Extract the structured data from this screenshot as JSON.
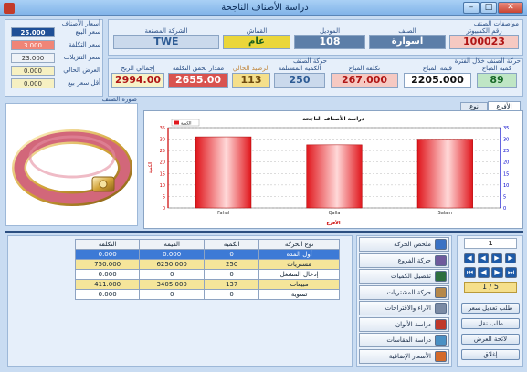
{
  "window": {
    "title": "دراسة الأصناف الناجحة",
    "min": "–",
    "max": "□",
    "close": "✕"
  },
  "spec": {
    "header": "مواصفات الصنف",
    "computer_no_label": "رقم الكمبيوتر",
    "computer_no": "100023",
    "category_label": "الصنف",
    "category": "اسوارة",
    "model_label": "الموديل",
    "model": "108",
    "material_label": "القماش",
    "material": "عام",
    "manufacturer_label": "الشركة المصنعة",
    "manufacturer": "TWE"
  },
  "prices": {
    "header": "أسعار الأصناف",
    "sale_label": "سعر البيع",
    "sale": "25.000",
    "cost_label": "سعر التكلفة",
    "cost": "3.000",
    "discount_label": "سعر التنزيلات",
    "discount": "23.000",
    "offer_label": "العرض الحالي",
    "offer": "0.000",
    "min_label": "أقل سعر بيع",
    "min": "0.000"
  },
  "movement_period": {
    "header": "حركة الصنف خلال الفترة",
    "qty_sold_label": "كمية المباع",
    "qty_sold": "89",
    "value_sold_label": "قيمة المباع",
    "value_sold": "2205.000",
    "cost_sold_label": "تكلفة المباع",
    "cost_sold": "267.000"
  },
  "movement": {
    "header": "حركة الصنف",
    "qty_received_label": "الكمية المستلمة",
    "qty_received": "250",
    "current_balance_label": "الرصيد الحالي",
    "current_balance": "113",
    "cost_realized_label": "مقدار تحقق التكلفة",
    "cost_realized": "2655.00",
    "total_profit_label": "إجمالي الربح",
    "total_profit": "2994.00"
  },
  "image_label": "صورة الصنف",
  "tabs": [
    "الأفرع",
    "نوع السعر"
  ],
  "chart_data": {
    "type": "bar",
    "title": "دراسة الأصناف الناجحة",
    "categories": [
      "Fahal",
      "Qalla",
      "Salam"
    ],
    "values": [
      31,
      27.5,
      30
    ],
    "ylim": [
      0,
      35
    ],
    "yticks": [
      0,
      5,
      10,
      15,
      20,
      25,
      30,
      35
    ],
    "xlabel": "الأفرع",
    "ylabel": "الكمية",
    "legend": [
      "الكمية"
    ],
    "legend_position": "top-left",
    "grid": true,
    "bar_color": "#e0161c"
  },
  "table": {
    "headers": [
      "نوع الحركة",
      "الكمية",
      "القيمة",
      "التكلفة"
    ],
    "rows": [
      {
        "type": "أول المدة",
        "qty": "0",
        "value": "0.000",
        "cost": "0.000",
        "style": "selected"
      },
      {
        "type": "مشتريات",
        "qty": "250",
        "value": "6250.000",
        "cost": "750.000",
        "style": "yellow"
      },
      {
        "type": "إدخال المشغل",
        "qty": "0",
        "value": "0",
        "cost": "0.000",
        "style": "white"
      },
      {
        "type": "مبيعات",
        "qty": "137",
        "value": "3405.000",
        "cost": "411.000",
        "style": "yellow"
      },
      {
        "type": "تسوية",
        "qty": "0",
        "value": "0",
        "cost": "0.000",
        "style": "white"
      }
    ]
  },
  "tools": [
    {
      "label": "ملخص الحركة",
      "icon": "chart-icon"
    },
    {
      "label": "حركة الفروع",
      "icon": "branches-icon"
    },
    {
      "label": "تفصيل الكميات",
      "icon": "quantities-icon"
    },
    {
      "label": "حركة المشتريات",
      "icon": "purchases-icon"
    },
    {
      "label": "الآراء والاقتراحات",
      "icon": "feedback-icon"
    },
    {
      "label": "دراسة الألوان",
      "icon": "colors-icon"
    },
    {
      "label": "دراسة المقاسات",
      "icon": "sizes-icon"
    },
    {
      "label": "الأسعار الإضافية",
      "icon": "extra-prices-icon"
    }
  ],
  "nav": {
    "record": "1",
    "counter": "1 / 5"
  },
  "actions": {
    "price_request": "طلب تعديل سعر",
    "transfer_request": "طلب نقل",
    "display_list": "لائحة العرض",
    "close": "إغلاق"
  },
  "colors": {
    "title_bar": "#7fb2e8",
    "profit": "#f7f2c8",
    "cost_realized": "#d9534f"
  }
}
